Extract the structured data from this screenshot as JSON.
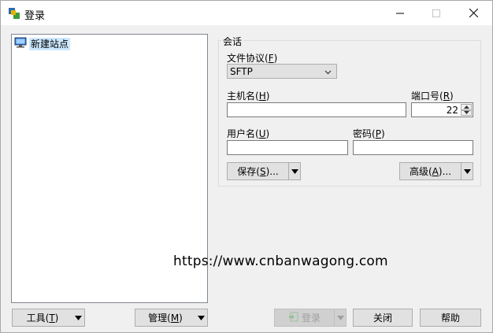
{
  "window": {
    "title": "登录",
    "app_icon": "winscp-icon"
  },
  "tree": {
    "items": [
      {
        "label": "新建站点",
        "icon": "computer-icon"
      }
    ]
  },
  "session": {
    "group_title": "会话",
    "protocol": {
      "label_pre": "文件协议(",
      "label_key": "F",
      "label_post": ")",
      "value": "SFTP"
    },
    "host": {
      "label_pre": "主机名(",
      "label_key": "H",
      "label_post": ")",
      "value": ""
    },
    "port": {
      "label_pre": "端口号(",
      "label_key": "R",
      "label_post": ")",
      "value": "22"
    },
    "user": {
      "label_pre": "用户名(",
      "label_key": "U",
      "label_post": ")",
      "value": ""
    },
    "password": {
      "label_pre": "密码(",
      "label_key": "P",
      "label_post": ")",
      "value": ""
    },
    "save_button": {
      "pre": "保存(",
      "key": "S",
      "post": ")..."
    },
    "advanced_button": {
      "pre": "高级(",
      "key": "A",
      "post": ")..."
    }
  },
  "bottom": {
    "tools_button": {
      "pre": "工具(",
      "key": "T",
      "post": ")"
    },
    "manage_button": {
      "pre": "管理(",
      "key": "M",
      "post": ")"
    },
    "login_button": "登录",
    "close_button": "关闭",
    "help_button": "帮助"
  },
  "watermark": "https://www.cnbanwagong.com"
}
